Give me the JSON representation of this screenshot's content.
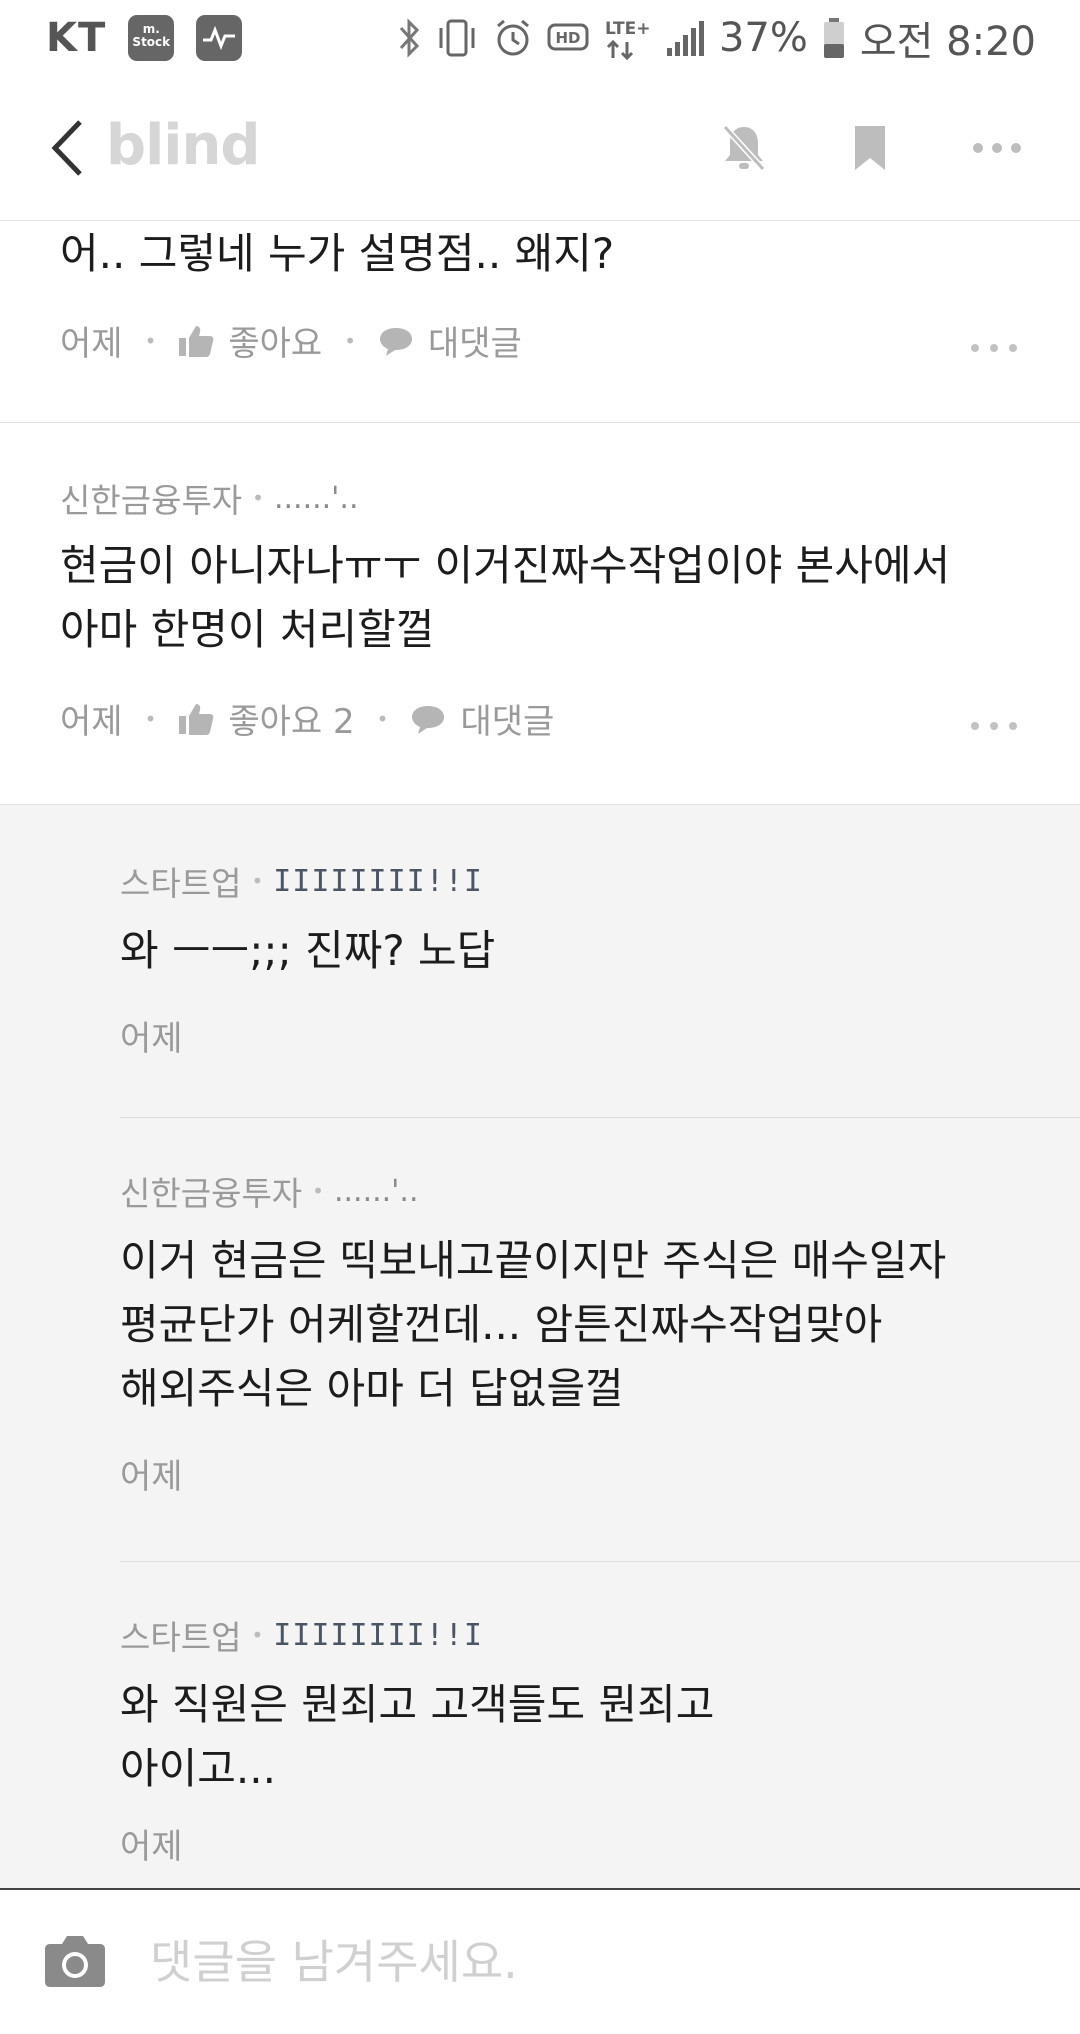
{
  "status_bar": {
    "carrier": "KT",
    "app_badge_line1": "m.",
    "app_badge_line2": "Stock",
    "network": "LTE+",
    "battery": "37%",
    "time": "오전 8:20"
  },
  "app_bar": {
    "brand": "blind",
    "icons": [
      "back-icon",
      "bell-off-icon",
      "bookmark-icon",
      "more-icon"
    ]
  },
  "comments": [
    {
      "body": "어.. 그렇네 누가 설명점.. 왜지?",
      "time": "어제",
      "like_label": "좋아요",
      "reply_label": "대댓글"
    },
    {
      "company": "신한금융투자",
      "nickname": "......'..",
      "body_line1": "현금이 아니자나ㅠㅜ 이거진짜수작업이야 본사에서",
      "body_line2": "아마 한명이 처리할껄",
      "time": "어제",
      "like_label": "좋아요 2",
      "reply_label": "대댓글"
    }
  ],
  "replies": [
    {
      "company": "스타트업",
      "nickname": "IIIIIIII!!I",
      "body_line1": "와 ㅡㅡ;;; 진짜? 노답",
      "time": "어제"
    },
    {
      "company": "신한금융투자",
      "nickname": "......'..",
      "body_line1": "이거 현금은 띡보내고끝이지만 주식은 매수일자",
      "body_line2": "평균단가 어케할껀데...  암튼진짜수작업맞아",
      "body_line3": "해외주식은 아마 더 답없을껄",
      "time": "어제"
    },
    {
      "company": "스타트업",
      "nickname": "IIIIIIII!!I",
      "body_line1": "와 직원은 뭔죄고 고객들도 뭔죄고",
      "body_line2": "아이고...",
      "time": "어제"
    }
  ],
  "input": {
    "placeholder": "댓글을 남겨주세요."
  },
  "colors": {
    "muted_text": "#9a9a9a",
    "reply_background": "#f4f4f4",
    "brand_gray": "#d6d6d6"
  }
}
